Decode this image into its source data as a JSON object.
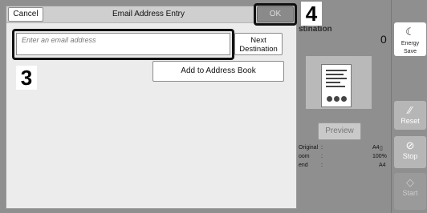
{
  "background": {
    "destination_label": "stination",
    "destination_count": "0",
    "preview_label": "Preview",
    "info_rows": [
      {
        "label": "Original",
        "value": "A4"
      },
      {
        "label": "oom",
        "value": "100%"
      },
      {
        "label": "end",
        "value": "A4"
      }
    ]
  },
  "side_bar": {
    "energy_save": "Energy Save",
    "reset": "Reset",
    "stop": "Stop",
    "start": "Start"
  },
  "dialog": {
    "title": "Email Address Entry",
    "cancel_label": "Cancel",
    "ok_label": "OK",
    "email_placeholder": "Enter an email address",
    "email_value": "",
    "next_destination_line1": "Next",
    "next_destination_line2": "Destination",
    "add_to_address_book": "Add to Address Book"
  },
  "callouts": {
    "step3": "3",
    "step4": "4"
  },
  "colors": {
    "dialog_bg": "#ececec",
    "titlebar_bg": "#cfcfcf",
    "ok_disabled_bg": "#8a8a8a",
    "screen_bg": "#8f8f8f"
  }
}
